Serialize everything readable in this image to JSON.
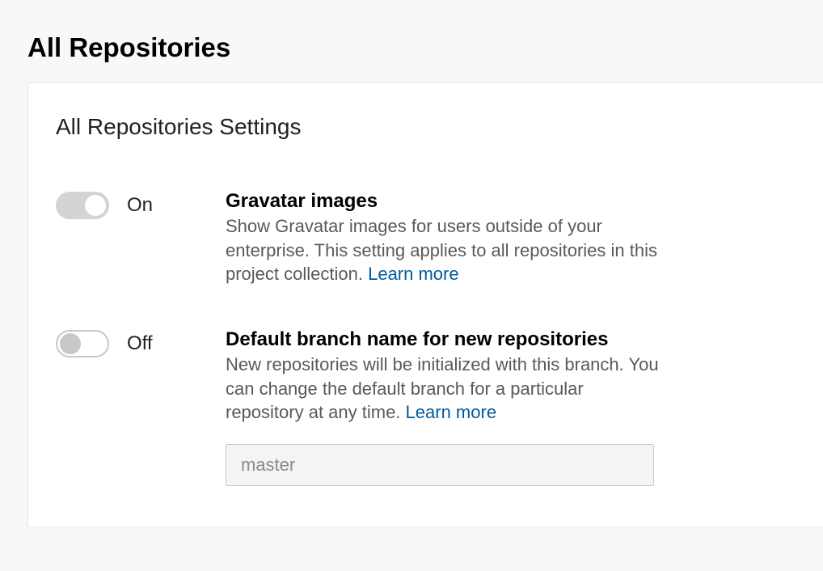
{
  "page": {
    "title": "All Repositories"
  },
  "card": {
    "title": "All Repositories Settings"
  },
  "settings": {
    "gravatar": {
      "toggle_state": "On",
      "title": "Gravatar images",
      "description": "Show Gravatar images for users outside of your enterprise. This setting applies to all repositories in this project collection. ",
      "learn_more": "Learn more"
    },
    "default_branch": {
      "toggle_state": "Off",
      "title": "Default branch name for new repositories",
      "description": "New repositories will be initialized with this branch. You can change the default branch for a particular repository at any time. ",
      "learn_more": "Learn more",
      "input_placeholder": "master"
    }
  }
}
